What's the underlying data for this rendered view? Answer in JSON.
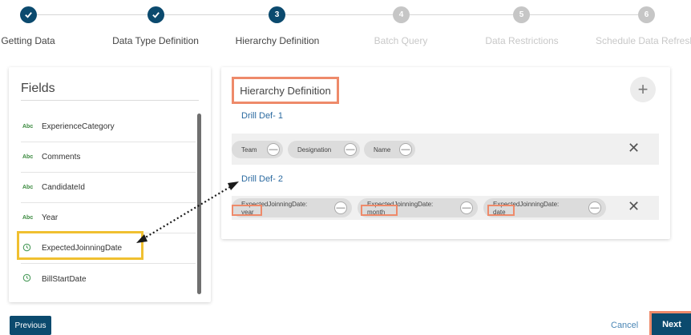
{
  "stepper": {
    "steps": [
      {
        "label": "Getting Data",
        "number": "",
        "state": "done"
      },
      {
        "label": "Data Type Definition",
        "number": "",
        "state": "done"
      },
      {
        "label": "Hierarchy Definition",
        "number": "3",
        "state": "active"
      },
      {
        "label": "Batch Query",
        "number": "4",
        "state": "todo"
      },
      {
        "label": "Data Restrictions",
        "number": "5",
        "state": "todo"
      },
      {
        "label": "Schedule Data Refresh",
        "number": "6",
        "state": "todo"
      }
    ],
    "check_icon": "check-icon"
  },
  "fields": {
    "title": "Fields",
    "items": [
      {
        "type": "Abc",
        "name": "ExperienceCategory"
      },
      {
        "type": "Abc",
        "name": "Comments"
      },
      {
        "type": "Abc",
        "name": "CandidateId"
      },
      {
        "type": "Abc",
        "name": "Year"
      },
      {
        "type": "clock",
        "name": "ExpectedJoinningDate"
      },
      {
        "type": "clock",
        "name": "BillStartDate"
      }
    ]
  },
  "hierarchy": {
    "title": "Hierarchy Definition",
    "add_icon": "+",
    "drills": [
      {
        "label": "Drill Def- 1",
        "chips": [
          "Team",
          "Designation",
          "Name"
        ]
      },
      {
        "label": "Drill Def- 2",
        "chips": [
          {
            "field": "ExpectedJoinningDate:",
            "part": "year"
          },
          {
            "field": "ExpectedJoinningDate:",
            "part": "month"
          },
          {
            "field": "ExpectedJoinningDate:",
            "part": "date"
          }
        ]
      }
    ],
    "remove_glyph": "—",
    "delete_glyph": "✕"
  },
  "footer": {
    "previous_label": "Previous",
    "cancel_label": "Cancel",
    "next_label": "Next"
  },
  "colors": {
    "primary": "#0b4a6e",
    "highlight_orange": "#ee8a6a",
    "highlight_yellow": "#f0c030",
    "link": "#2b6aa0"
  }
}
